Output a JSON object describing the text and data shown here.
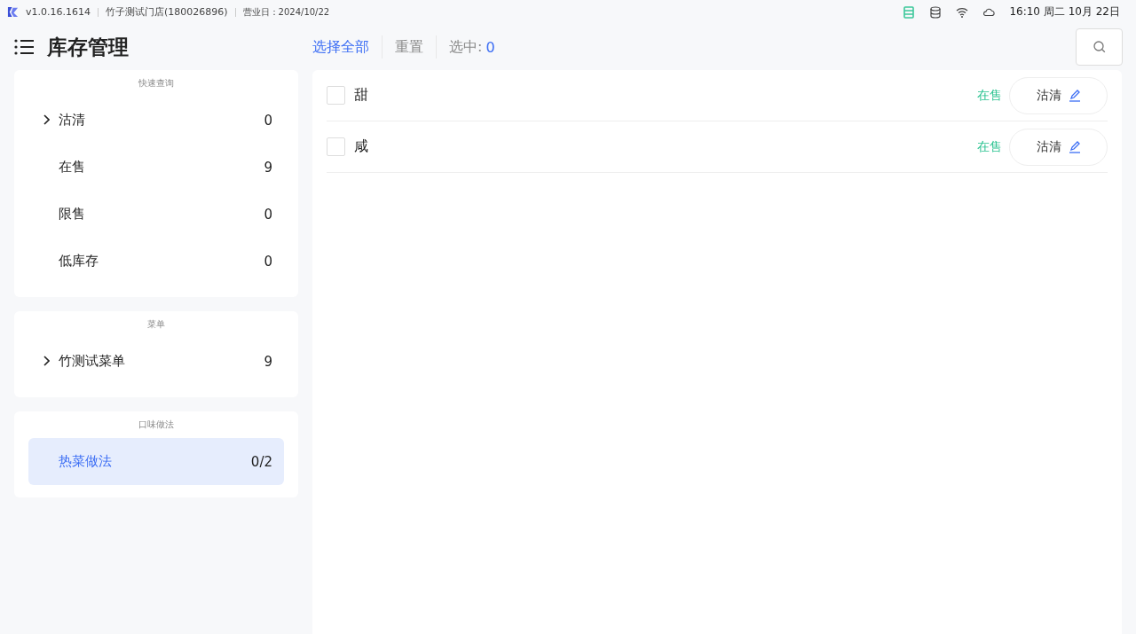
{
  "status_bar": {
    "version": "v1.0.16.1614",
    "store": "竹子测试门店(180026896)",
    "business_day": "营业日：2024/10/22",
    "clock": "16:10 周二 10月 22日"
  },
  "header": {
    "title": "库存管理",
    "select_all": "选择全部",
    "reset": "重置",
    "selected_label": "选中:",
    "selected_count": "0"
  },
  "sidebar": {
    "sections": [
      {
        "title": "快速查询",
        "items": [
          {
            "kind": "group",
            "label": "沽清",
            "count": "0",
            "selected": false
          },
          {
            "kind": "leaf",
            "label": "在售",
            "count": "9",
            "selected": false
          },
          {
            "kind": "leaf",
            "label": "限售",
            "count": "0",
            "selected": false
          },
          {
            "kind": "leaf",
            "label": "低库存",
            "count": "0",
            "selected": false
          }
        ]
      },
      {
        "title": "菜单",
        "items": [
          {
            "kind": "group",
            "label": "竹测试菜单",
            "count": "9",
            "selected": false
          }
        ]
      },
      {
        "title": "口味做法",
        "items": [
          {
            "kind": "leaf",
            "label": "热菜做法",
            "count": "0/2",
            "selected": true
          }
        ]
      }
    ]
  },
  "rows": [
    {
      "name": "甜",
      "checked": false,
      "status": "在售",
      "action": "沽清"
    },
    {
      "name": "咸",
      "checked": false,
      "status": "在售",
      "action": "沽清"
    }
  ]
}
